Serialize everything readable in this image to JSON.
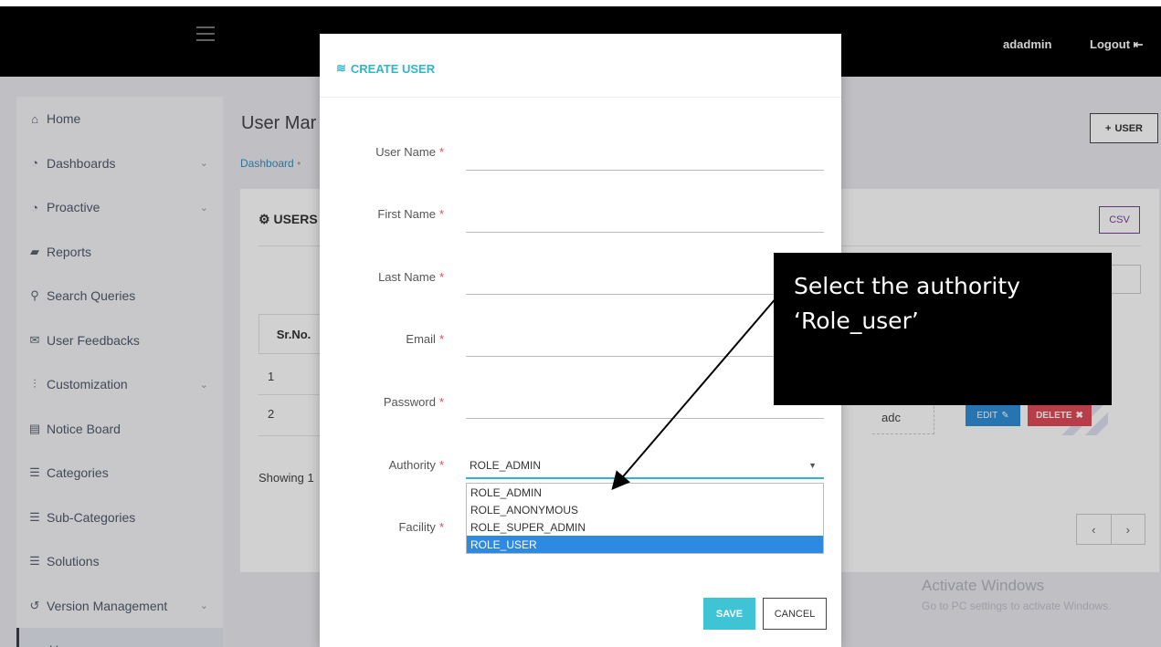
{
  "topbar": {
    "username": "adadmin",
    "logout_label": "Logout"
  },
  "page": {
    "title": "User Mar",
    "breadcrumb": "Dashboard",
    "add_user_label": "USER",
    "panel_title": "USERS",
    "csv_label": "CSV",
    "table": {
      "header_sr": "Sr.No.",
      "rows": [
        {
          "sr": "1"
        },
        {
          "sr": "2"
        }
      ],
      "row2_name": "adc",
      "edit_label": "EDIT",
      "delete_label": "DELETE"
    },
    "showing": "Showing 1",
    "pager": {
      "prev": "‹",
      "next": "›"
    }
  },
  "sidebar": {
    "items": [
      {
        "label": "Home",
        "icon": "home-icon",
        "glyph": "⌂"
      },
      {
        "label": "Dashboards",
        "icon": "dashboard-icon",
        "glyph": "◔",
        "chevron": true
      },
      {
        "label": "Proactive",
        "icon": "gauge-icon",
        "glyph": "◔",
        "chevron": true
      },
      {
        "label": "Reports",
        "icon": "folder-icon",
        "glyph": "▰"
      },
      {
        "label": "Search Queries",
        "icon": "search-icon",
        "glyph": "⚲"
      },
      {
        "label": "User Feedbacks",
        "icon": "envelope-icon",
        "glyph": "✉"
      },
      {
        "label": "Customization",
        "icon": "sliders-icon",
        "glyph": "⫶",
        "chevron": true
      },
      {
        "label": "Notice Board",
        "icon": "newspaper-icon",
        "glyph": "▤"
      },
      {
        "label": "Categories",
        "icon": "list-icon",
        "glyph": "☰"
      },
      {
        "label": "Sub-Categories",
        "icon": "list-icon",
        "glyph": "☰"
      },
      {
        "label": "Solutions",
        "icon": "list-icon",
        "glyph": "☰"
      },
      {
        "label": "Version Management",
        "icon": "history-icon",
        "glyph": "↺",
        "chevron": true
      },
      {
        "label": "Users",
        "icon": "users-icon",
        "glyph": "☻"
      }
    ]
  },
  "modal": {
    "title": "CREATE USER",
    "fields": {
      "username": "User Name",
      "first_name": "First Name",
      "last_name": "Last Name",
      "email": "Email",
      "password": "Password",
      "authority": "Authority",
      "facility": "Facility"
    },
    "required_mark": "*",
    "authority_value": "ROLE_ADMIN",
    "authority_options": [
      "ROLE_ADMIN",
      "ROLE_ANONYMOUS",
      "ROLE_SUPER_ADMIN",
      "ROLE_USER"
    ],
    "highlighted_option": "ROLE_USER",
    "save_label": "SAVE",
    "cancel_label": "CANCEL"
  },
  "callout": {
    "line1": "Select the authority",
    "line2": "‘Role_user’"
  },
  "watermark": {
    "title": "Activate Windows",
    "subtitle": "Go to PC settings to activate Windows."
  },
  "colors": {
    "accent": "#2fb6cc",
    "danger": "#e04b59",
    "primary": "#2e8ae0",
    "csv": "#7d3c98"
  }
}
